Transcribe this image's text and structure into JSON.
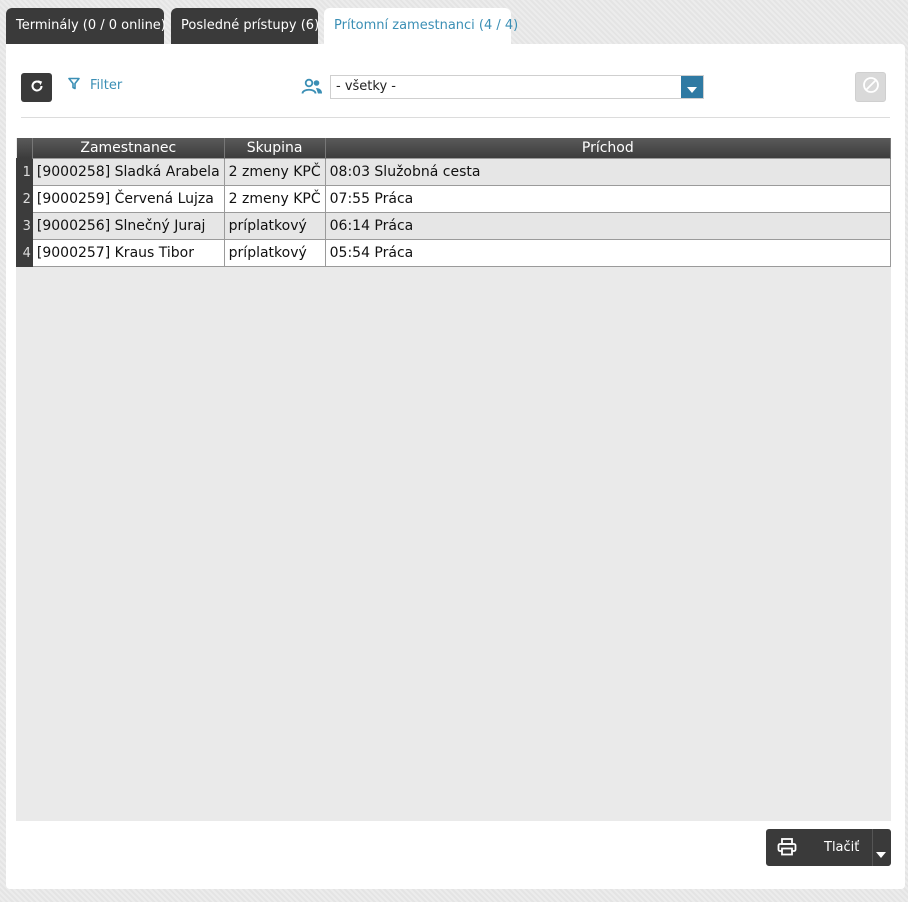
{
  "tabs": [
    {
      "label": "Terminály (0 / 0 online)"
    },
    {
      "label": "Posledné prístupy (6)"
    },
    {
      "label": "Prítomní zamestnanci (4 / 4)"
    }
  ],
  "toolbar": {
    "filter_label": "Filter",
    "group_select_value": "- všetky -"
  },
  "table": {
    "columns": [
      "Zamestnanec",
      "Skupina",
      "Príchod"
    ],
    "rows": [
      {
        "num": "1",
        "employee": "[9000258] Sladká Arabela",
        "group": "2 zmeny KPČ",
        "arrival": "08:03 Služobná cesta"
      },
      {
        "num": "2",
        "employee": "[9000259] Červená Lujza",
        "group": "2 zmeny KPČ",
        "arrival": "07:55 Práca"
      },
      {
        "num": "3",
        "employee": "[9000256] Slnečný Juraj",
        "group": "príplatkový",
        "arrival": "06:14 Práca"
      },
      {
        "num": "4",
        "employee": "[9000257] Kraus Tibor",
        "group": "príplatkový",
        "arrival": "05:54 Práca"
      }
    ]
  },
  "footer": {
    "print_label": "Tlačiť"
  },
  "colors": {
    "accent": "#3b8fb5",
    "dark": "#3a3a3a",
    "select_arrow": "#2f7aa3"
  }
}
